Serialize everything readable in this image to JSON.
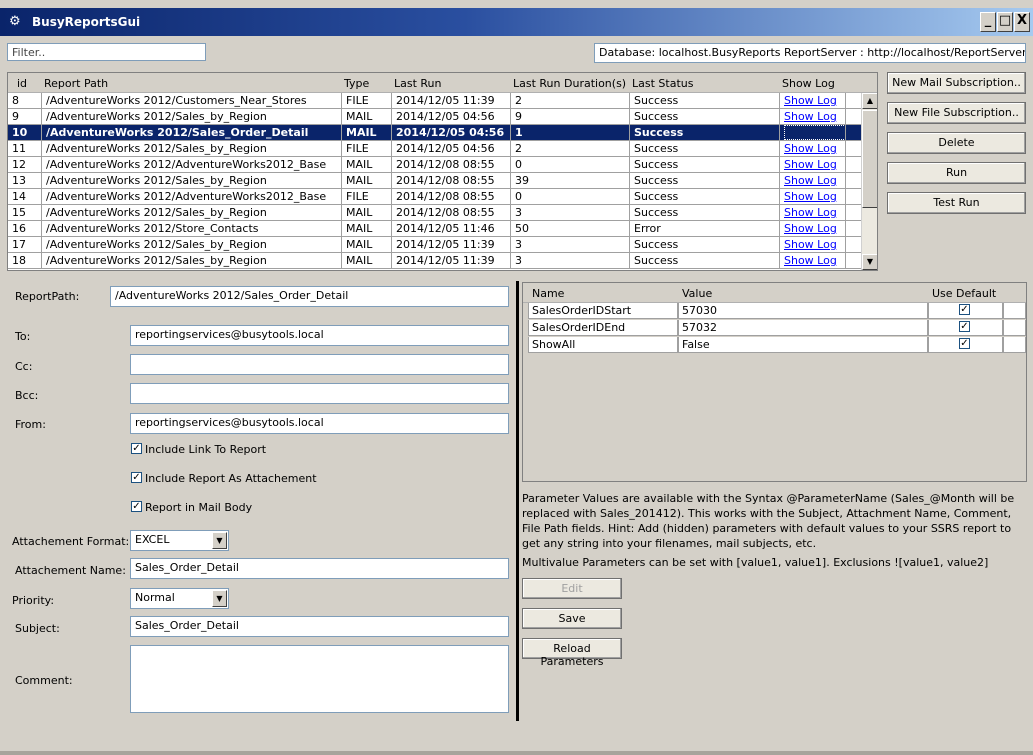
{
  "window": {
    "title": "BusyReportsGui",
    "icon": "gears-icon",
    "minimize": "_",
    "maximize": "□",
    "close": "X"
  },
  "top": {
    "filter_placeholder": "Filter..",
    "database_info": "Database: localhost.BusyReports ReportServer : http://localhost/ReportServer/ReportSe"
  },
  "grid": {
    "columns": [
      "id",
      "Report Path",
      "Type",
      "Last Run",
      "Last Run Duration(s)",
      "Last Status",
      "Show Log"
    ],
    "rows": [
      {
        "id": "8",
        "path": "/AdventureWorks 2012/Customers_Near_Stores",
        "type": "FILE",
        "last_run": "2014/12/05 11:39",
        "duration": "2",
        "status": "Success",
        "log": "Show Log"
      },
      {
        "id": "9",
        "path": "/AdventureWorks 2012/Sales_by_Region",
        "type": "MAIL",
        "last_run": "2014/12/05 04:56",
        "duration": "9",
        "status": "Success",
        "log": "Show Log"
      },
      {
        "id": "10",
        "path": "/AdventureWorks 2012/Sales_Order_Detail",
        "type": "MAIL",
        "last_run": "2014/12/05 04:56",
        "duration": "1",
        "status": "Success",
        "log": "Show Log",
        "selected": true
      },
      {
        "id": "11",
        "path": "/AdventureWorks 2012/Sales_by_Region",
        "type": "FILE",
        "last_run": "2014/12/05 04:56",
        "duration": "2",
        "status": "Success",
        "log": "Show Log"
      },
      {
        "id": "12",
        "path": "/AdventureWorks 2012/AdventureWorks2012_Base",
        "type": "MAIL",
        "last_run": "2014/12/08 08:55",
        "duration": "0",
        "status": "Success",
        "log": "Show Log"
      },
      {
        "id": "13",
        "path": "/AdventureWorks 2012/Sales_by_Region",
        "type": "MAIL",
        "last_run": "2014/12/08 08:55",
        "duration": "39",
        "status": "Success",
        "log": "Show Log"
      },
      {
        "id": "14",
        "path": "/AdventureWorks 2012/AdventureWorks2012_Base",
        "type": "FILE",
        "last_run": "2014/12/08 08:55",
        "duration": "0",
        "status": "Success",
        "log": "Show Log"
      },
      {
        "id": "15",
        "path": "/AdventureWorks 2012/Sales_by_Region",
        "type": "MAIL",
        "last_run": "2014/12/08 08:55",
        "duration": "3",
        "status": "Success",
        "log": "Show Log"
      },
      {
        "id": "16",
        "path": "/AdventureWorks 2012/Store_Contacts",
        "type": "MAIL",
        "last_run": "2014/12/05 11:46",
        "duration": "50",
        "status": "Error",
        "log": "Show Log"
      },
      {
        "id": "17",
        "path": "/AdventureWorks 2012/Sales_by_Region",
        "type": "MAIL",
        "last_run": "2014/12/05 11:39",
        "duration": "3",
        "status": "Success",
        "log": "Show Log"
      },
      {
        "id": "18",
        "path": "/AdventureWorks 2012/Sales_by_Region",
        "type": "MAIL",
        "last_run": "2014/12/05 11:39",
        "duration": "3",
        "status": "Success",
        "log": "Show Log"
      }
    ]
  },
  "actions": {
    "new_mail": "New Mail Subscription..",
    "new_file": "New File Subscription..",
    "delete": "Delete",
    "run": "Run",
    "test_run": "Test Run"
  },
  "form": {
    "report_path_label": "ReportPath:",
    "report_path": "/AdventureWorks 2012/Sales_Order_Detail",
    "to_label": "To:",
    "to": "reportingservices@busytools.local",
    "cc_label": "Cc:",
    "cc": "",
    "bcc_label": "Bcc:",
    "bcc": "",
    "from_label": "From:",
    "from": "reportingservices@busytools.local",
    "include_link_label": "Include Link To Report",
    "include_link": true,
    "include_attachment_label": "Include Report As Attachement",
    "include_attachment": true,
    "report_in_body_label": "Report in Mail Body",
    "report_in_body": true,
    "attachment_format_label": "Attachement Format:",
    "attachment_format": "EXCEL",
    "attachment_name_label": "Attachement Name:",
    "attachment_name": "Sales_Order_Detail",
    "priority_label": "Priority:",
    "priority": "Normal",
    "subject_label": "Subject:",
    "subject": "Sales_Order_Detail",
    "comment_label": "Comment:",
    "comment": ""
  },
  "params": {
    "columns": [
      "Name",
      "Value",
      "Use Default"
    ],
    "rows": [
      {
        "name": "SalesOrderIDStart",
        "value": "57030",
        "use_default": true
      },
      {
        "name": "SalesOrderIDEnd",
        "value": "57032",
        "use_default": true
      },
      {
        "name": "ShowAll",
        "value": "False",
        "use_default": true
      }
    ],
    "help_text": "Parameter Values are available with the Syntax @ParameterName (Sales_@Month will be replaced with Sales_201412). This works with the Subject, Attachment Name, Comment, File Path fields. Hint: Add (hidden) parameters with default values to your SSRS report to get any string into your filenames, mail subjects, etc.",
    "multivalue_text": "Multivalue Parameters can be set with [value1, value1]. Exclusions ![value1, value2]",
    "edit": "Edit",
    "save": "Save",
    "reload": "Reload Parameters"
  }
}
